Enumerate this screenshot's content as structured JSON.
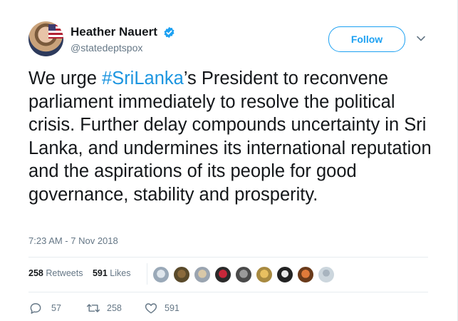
{
  "author": {
    "name": "Heather Nauert",
    "handle": "@statedeptspox"
  },
  "follow_label": "Follow",
  "tweet": {
    "text_before": "We urge ",
    "hashtag": "#SriLanka",
    "text_after": "’s President to reconvene parliament immediately to resolve the political crisis. Further delay compounds uncertainty in Sri Lanka, and undermines its international reputation and the aspirations of its people for good governance, stability and prosperity."
  },
  "timestamp": "7:23 AM - 7 Nov 2018",
  "stats": {
    "retweets_count": "258",
    "retweets_label": "Retweets",
    "likes_count": "591",
    "likes_label": "Likes"
  },
  "actions": {
    "replies": "57",
    "retweets": "258",
    "likes": "591"
  },
  "colors": {
    "accent": "#1da1f2",
    "hashtag": "#1b95e0",
    "muted": "#657786"
  },
  "icons": [
    "verified-badge-icon",
    "chevron-down-icon",
    "reply-icon",
    "retweet-icon",
    "heart-icon"
  ]
}
